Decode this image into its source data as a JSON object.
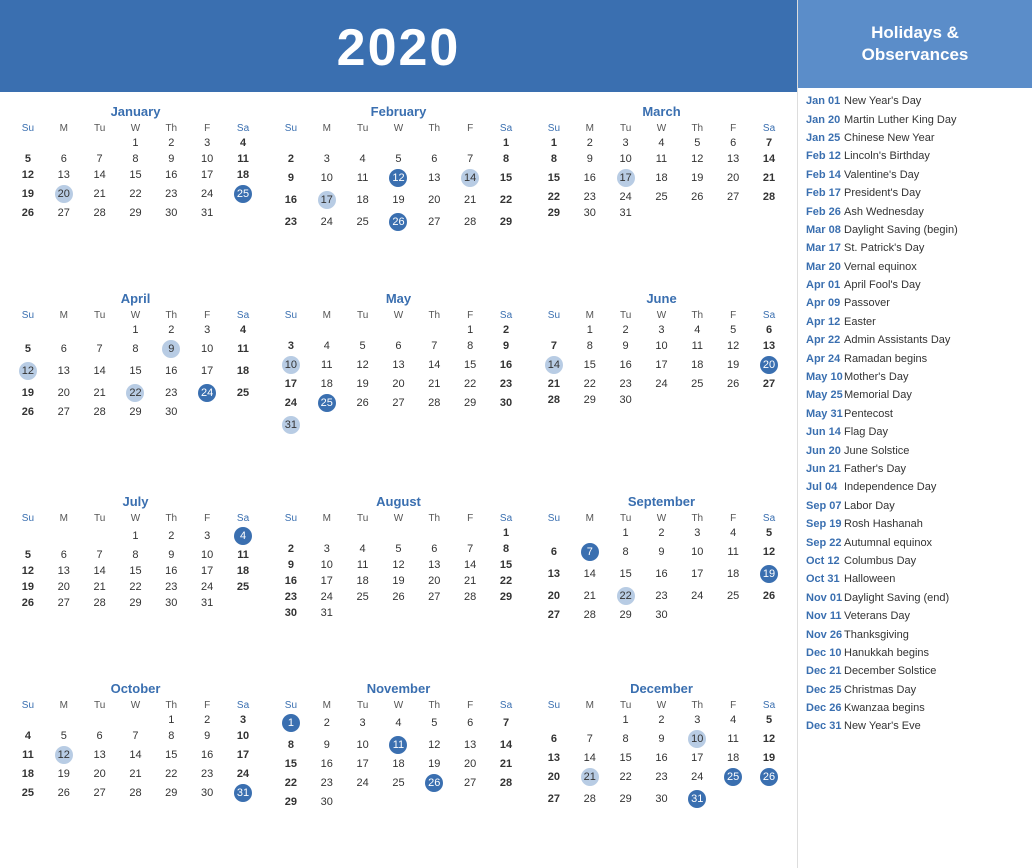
{
  "header": {
    "year": "2020"
  },
  "holidays_panel": {
    "title": "Holidays &\nObservances",
    "items": [
      {
        "date": "Jan 01",
        "name": "New Year's Day"
      },
      {
        "date": "Jan 20",
        "name": "Martin Luther King Day"
      },
      {
        "date": "Jan 25",
        "name": "Chinese New Year"
      },
      {
        "date": "Feb 12",
        "name": "Lincoln's Birthday"
      },
      {
        "date": "Feb 14",
        "name": "Valentine's Day"
      },
      {
        "date": "Feb 17",
        "name": "President's Day"
      },
      {
        "date": "Feb 26",
        "name": "Ash Wednesday"
      },
      {
        "date": "Mar 08",
        "name": "Daylight Saving (begin)"
      },
      {
        "date": "Mar 17",
        "name": "St. Patrick's Day"
      },
      {
        "date": "Mar 20",
        "name": "Vernal equinox"
      },
      {
        "date": "Apr 01",
        "name": "April Fool's Day"
      },
      {
        "date": "Apr 09",
        "name": "Passover"
      },
      {
        "date": "Apr 12",
        "name": "Easter"
      },
      {
        "date": "Apr 22",
        "name": "Admin Assistants Day"
      },
      {
        "date": "Apr 24",
        "name": "Ramadan begins"
      },
      {
        "date": "May 10",
        "name": "Mother's Day"
      },
      {
        "date": "May 25",
        "name": "Memorial Day"
      },
      {
        "date": "May 31",
        "name": "Pentecost"
      },
      {
        "date": "Jun 14",
        "name": "Flag Day"
      },
      {
        "date": "Jun 20",
        "name": "June Solstice"
      },
      {
        "date": "Jun 21",
        "name": "Father's Day"
      },
      {
        "date": "Jul 04",
        "name": "Independence Day"
      },
      {
        "date": "Sep 07",
        "name": "Labor Day"
      },
      {
        "date": "Sep 19",
        "name": "Rosh Hashanah"
      },
      {
        "date": "Sep 22",
        "name": "Autumnal equinox"
      },
      {
        "date": "Oct 12",
        "name": "Columbus Day"
      },
      {
        "date": "Oct 31",
        "name": "Halloween"
      },
      {
        "date": "Nov 01",
        "name": "Daylight Saving (end)"
      },
      {
        "date": "Nov 11",
        "name": "Veterans Day"
      },
      {
        "date": "Nov 26",
        "name": "Thanksgiving"
      },
      {
        "date": "Dec 10",
        "name": "Hanukkah begins"
      },
      {
        "date": "Dec 21",
        "name": "December Solstice"
      },
      {
        "date": "Dec 25",
        "name": "Christmas Day"
      },
      {
        "date": "Dec 26",
        "name": "Kwanzaa begins"
      },
      {
        "date": "Dec 31",
        "name": "New Year's Eve"
      }
    ]
  },
  "months": [
    {
      "name": "January",
      "weeks": [
        [
          "",
          "",
          "",
          "1",
          "2",
          "3",
          "4"
        ],
        [
          "5",
          "6",
          "7",
          "8",
          "9",
          "10",
          "11"
        ],
        [
          "12",
          "13",
          "14",
          "15",
          "16",
          "17",
          "18"
        ],
        [
          "19",
          "20h",
          "21",
          "22",
          "23",
          "24",
          "25b"
        ],
        [
          "26",
          "27",
          "28",
          "29",
          "30",
          "31",
          ""
        ]
      ]
    },
    {
      "name": "February",
      "weeks": [
        [
          "",
          "",
          "",
          "",
          "",
          "",
          "1"
        ],
        [
          "2",
          "3",
          "4",
          "5",
          "6",
          "7",
          "8"
        ],
        [
          "9",
          "10",
          "11",
          "12b",
          "13",
          "14h",
          "15"
        ],
        [
          "16",
          "17h",
          "18",
          "19",
          "20",
          "21",
          "22"
        ],
        [
          "23",
          "24",
          "25",
          "26b",
          "27",
          "28",
          "29"
        ]
      ]
    },
    {
      "name": "March",
      "weeks": [
        [
          "1",
          "2",
          "3",
          "4",
          "5",
          "6",
          "7"
        ],
        [
          "8",
          "9",
          "10",
          "11",
          "12",
          "13",
          "14"
        ],
        [
          "15",
          "16",
          "17h",
          "18",
          "19",
          "20",
          "21"
        ],
        [
          "22",
          "23",
          "24",
          "25",
          "26",
          "27",
          "28"
        ],
        [
          "29",
          "30",
          "31",
          "",
          "",
          "",
          ""
        ]
      ]
    },
    {
      "name": "April",
      "weeks": [
        [
          "",
          "",
          "",
          "1",
          "2",
          "3",
          "4"
        ],
        [
          "5",
          "6",
          "7",
          "8",
          "9h",
          "10",
          "11"
        ],
        [
          "12h",
          "13",
          "14",
          "15",
          "16",
          "17",
          "18"
        ],
        [
          "19",
          "20",
          "21",
          "22h",
          "23",
          "24b",
          "25"
        ],
        [
          "26",
          "27",
          "28",
          "29",
          "30",
          "",
          ""
        ]
      ]
    },
    {
      "name": "May",
      "weeks": [
        [
          "",
          "",
          "",
          "",
          "",
          "1",
          "2"
        ],
        [
          "3",
          "4",
          "5",
          "6",
          "7",
          "8",
          "9"
        ],
        [
          "10h",
          "11",
          "12",
          "13",
          "14",
          "15",
          "16"
        ],
        [
          "17",
          "18",
          "19",
          "20",
          "21",
          "22",
          "23"
        ],
        [
          "24",
          "25b",
          "26",
          "27",
          "28",
          "29",
          "30"
        ],
        [
          "31h",
          "",
          "",
          "",
          "",
          "",
          ""
        ]
      ]
    },
    {
      "name": "June",
      "weeks": [
        [
          "",
          "1",
          "2",
          "3",
          "4",
          "5",
          "6"
        ],
        [
          "7",
          "8",
          "9",
          "10",
          "11",
          "12",
          "13"
        ],
        [
          "14h",
          "15",
          "16",
          "17",
          "18",
          "19",
          "20b"
        ],
        [
          "21",
          "22",
          "23",
          "24",
          "25",
          "26",
          "27"
        ],
        [
          "28",
          "29",
          "30",
          "",
          "",
          "",
          ""
        ]
      ]
    },
    {
      "name": "July",
      "weeks": [
        [
          "",
          "",
          "",
          "1",
          "2",
          "3",
          "4b"
        ],
        [
          "5",
          "6",
          "7",
          "8",
          "9",
          "10",
          "11"
        ],
        [
          "12",
          "13",
          "14",
          "15",
          "16",
          "17",
          "18"
        ],
        [
          "19",
          "20",
          "21",
          "22",
          "23",
          "24",
          "25"
        ],
        [
          "26",
          "27",
          "28",
          "29",
          "30",
          "31",
          ""
        ]
      ]
    },
    {
      "name": "August",
      "weeks": [
        [
          "",
          "",
          "",
          "",
          "",
          "",
          "1"
        ],
        [
          "2",
          "3",
          "4",
          "5",
          "6",
          "7",
          "8"
        ],
        [
          "9",
          "10",
          "11",
          "12",
          "13",
          "14",
          "15"
        ],
        [
          "16",
          "17",
          "18",
          "19",
          "20",
          "21",
          "22"
        ],
        [
          "23",
          "24",
          "25",
          "26",
          "27",
          "28",
          "29"
        ],
        [
          "30",
          "31",
          "",
          "",
          "",
          "",
          ""
        ]
      ]
    },
    {
      "name": "September",
      "weeks": [
        [
          "",
          "",
          "1",
          "2",
          "3",
          "4",
          "5"
        ],
        [
          "6",
          "7b",
          "8",
          "9",
          "10",
          "11",
          "12"
        ],
        [
          "13",
          "14",
          "15",
          "16",
          "17",
          "18",
          "19b"
        ],
        [
          "20",
          "21",
          "22h",
          "23",
          "24",
          "25",
          "26"
        ],
        [
          "27",
          "28",
          "29",
          "30",
          "",
          "",
          ""
        ]
      ]
    },
    {
      "name": "October",
      "weeks": [
        [
          "",
          "",
          "",
          "",
          "1",
          "2",
          "3"
        ],
        [
          "4",
          "5",
          "6",
          "7",
          "8",
          "9",
          "10"
        ],
        [
          "11",
          "12h",
          "13",
          "14",
          "15",
          "16",
          "17"
        ],
        [
          "18",
          "19",
          "20",
          "21",
          "22",
          "23",
          "24"
        ],
        [
          "25",
          "26",
          "27",
          "28",
          "29",
          "30",
          "31b"
        ]
      ]
    },
    {
      "name": "November",
      "weeks": [
        [
          "1b",
          "2",
          "3",
          "4",
          "5",
          "6",
          "7"
        ],
        [
          "8",
          "9",
          "10",
          "11b",
          "12",
          "13",
          "14"
        ],
        [
          "15",
          "16",
          "17",
          "18",
          "19",
          "20",
          "21"
        ],
        [
          "22",
          "23",
          "24",
          "25",
          "26b",
          "27",
          "28"
        ],
        [
          "29",
          "30",
          "",
          "",
          "",
          "",
          ""
        ]
      ]
    },
    {
      "name": "December",
      "weeks": [
        [
          "",
          "",
          "1",
          "2",
          "3",
          "4",
          "5"
        ],
        [
          "6",
          "7",
          "8",
          "9",
          "10h",
          "11",
          "12"
        ],
        [
          "13",
          "14",
          "15",
          "16",
          "17",
          "18",
          "19"
        ],
        [
          "20",
          "21h",
          "22",
          "23",
          "24",
          "25b",
          "26b"
        ],
        [
          "27",
          "28",
          "29",
          "30",
          "31b",
          "",
          ""
        ]
      ]
    }
  ]
}
